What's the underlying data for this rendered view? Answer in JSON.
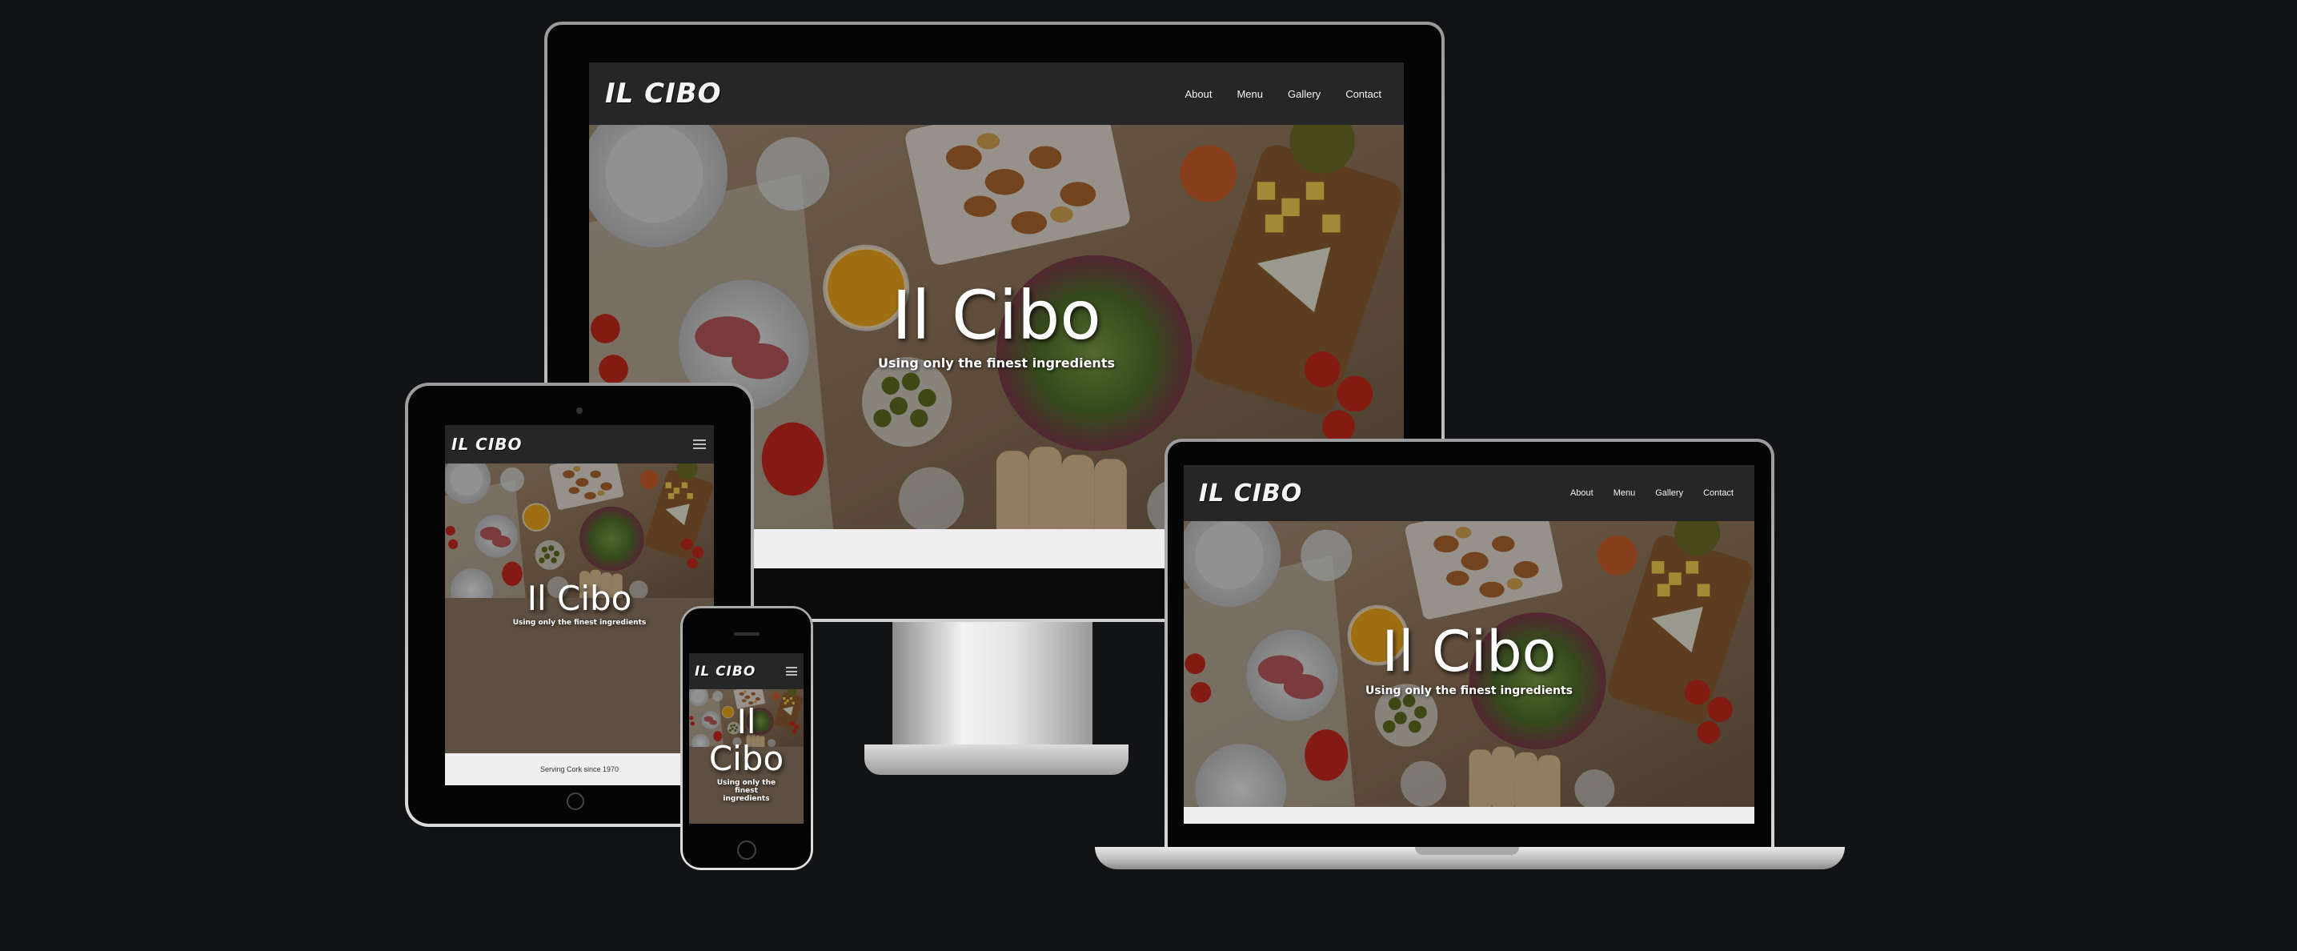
{
  "site": {
    "logo": "IL CIBO",
    "nav": [
      {
        "label": "About"
      },
      {
        "label": "Menu"
      },
      {
        "label": "Gallery"
      },
      {
        "label": "Contact"
      }
    ],
    "hero_title": "Il Cibo",
    "hero_subtitle": "Using only the finest ingredients",
    "footer_text": "Serving Cork since 1970"
  },
  "colors": {
    "page_background": "#121316",
    "navbar": "#262626",
    "footer": "#efefef"
  },
  "icons": [
    "hamburger-menu-icon",
    "home-button-icon",
    "camera-icon"
  ]
}
